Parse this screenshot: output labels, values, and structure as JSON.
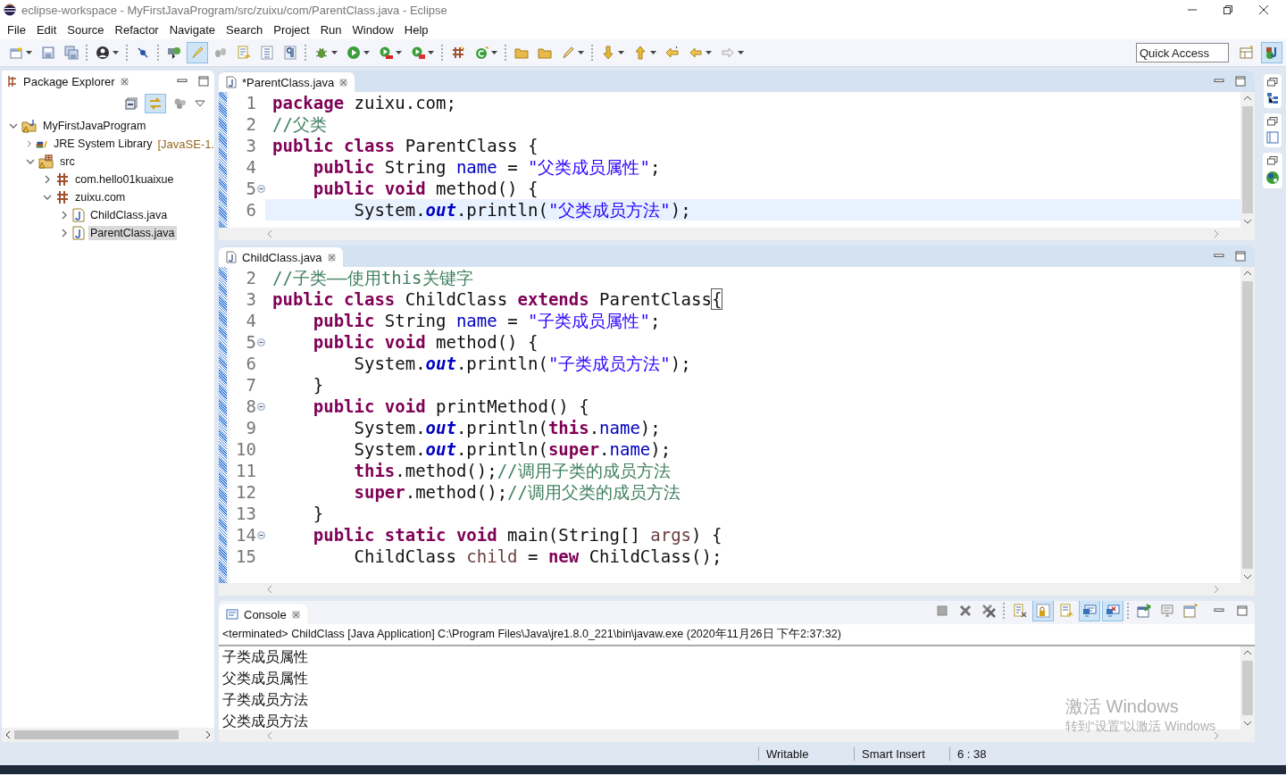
{
  "window": {
    "title": "eclipse-workspace - MyFirstJavaProgram/src/zuixu/com/ParentClass.java - Eclipse"
  },
  "menu": [
    "File",
    "Edit",
    "Source",
    "Refactor",
    "Navigate",
    "Search",
    "Project",
    "Run",
    "Window",
    "Help"
  ],
  "toolbar": [
    {
      "kind": "new",
      "dropdown": true,
      "pressed": false
    },
    {
      "kind": "save",
      "dropdown": false,
      "pressed": false
    },
    {
      "kind": "save-all",
      "dropdown": false,
      "pressed": false
    },
    {
      "kind": "separator"
    },
    {
      "kind": "person",
      "dropdown": true,
      "pressed": false
    },
    {
      "kind": "separator"
    },
    {
      "kind": "skip",
      "dropdown": false,
      "pressed": false
    },
    {
      "kind": "separator"
    },
    {
      "kind": "open-type",
      "dropdown": false,
      "pressed": false
    },
    {
      "kind": "highlighter",
      "dropdown": false,
      "pressed": true
    },
    {
      "kind": "footprints",
      "dropdown": false,
      "pressed": false
    },
    {
      "kind": "document",
      "dropdown": false,
      "pressed": false
    },
    {
      "kind": "list",
      "dropdown": false,
      "pressed": false
    },
    {
      "kind": "pilcrow",
      "dropdown": false,
      "pressed": false
    },
    {
      "kind": "separator"
    },
    {
      "kind": "bug",
      "dropdown": true,
      "pressed": false
    },
    {
      "kind": "run",
      "dropdown": true,
      "pressed": false
    },
    {
      "kind": "coverage",
      "dropdown": true,
      "pressed": false
    },
    {
      "kind": "tools",
      "dropdown": true,
      "pressed": false
    },
    {
      "kind": "separator"
    },
    {
      "kind": "grid",
      "dropdown": false,
      "pressed": false
    },
    {
      "kind": "new-class",
      "dropdown": true,
      "pressed": false
    },
    {
      "kind": "separator"
    },
    {
      "kind": "folder",
      "dropdown": false,
      "pressed": false
    },
    {
      "kind": "folder",
      "dropdown": false,
      "pressed": false
    },
    {
      "kind": "pen",
      "dropdown": true,
      "pressed": false
    },
    {
      "kind": "separator"
    },
    {
      "kind": "down-arrow",
      "dropdown": true,
      "pressed": false
    },
    {
      "kind": "up-arrow",
      "dropdown": true,
      "pressed": false
    },
    {
      "kind": "last-edit",
      "dropdown": false,
      "pressed": false
    },
    {
      "kind": "back",
      "dropdown": true,
      "pressed": false
    },
    {
      "kind": "forward",
      "dropdown": true,
      "pressed": false
    }
  ],
  "quick_access": {
    "placeholder": "Quick Access"
  },
  "perspectives": [
    {
      "kind": "open-perspective",
      "selected": false
    },
    {
      "kind": "java",
      "selected": true
    }
  ],
  "package_explorer": {
    "title": "Package Explorer",
    "tree": [
      {
        "label": "MyFirstJavaProgram",
        "kind": "project",
        "expanded": true,
        "selected": false,
        "children": [
          {
            "label": "JRE System Library",
            "decoration": "[JavaSE-1.",
            "kind": "library",
            "expanded": false,
            "selected": false
          },
          {
            "label": "src",
            "kind": "folder",
            "expanded": true,
            "selected": false,
            "children": [
              {
                "label": "com.hello01kuaixue",
                "kind": "package",
                "expanded": false,
                "selected": false
              },
              {
                "label": "zuixu.com",
                "kind": "package",
                "expanded": true,
                "selected": false,
                "children": [
                  {
                    "label": "ChildClass.java",
                    "kind": "java",
                    "expanded": false,
                    "selected": false
                  },
                  {
                    "label": "ParentClass.java",
                    "kind": "java",
                    "expanded": false,
                    "selected": true
                  }
                ]
              }
            ]
          }
        ]
      }
    ]
  },
  "editors": [
    {
      "tab": "*ParentClass.java",
      "lines": [
        {
          "num": "1",
          "foldable": false,
          "current": false,
          "tokens": [
            {
              "kind": "kw",
              "text": "package "
            },
            {
              "kind": "plain",
              "text": "zuixu.com;"
            }
          ]
        },
        {
          "num": "2",
          "foldable": false,
          "current": false,
          "tokens": [
            {
              "kind": "comment",
              "text": "//父类"
            }
          ]
        },
        {
          "num": "3",
          "foldable": false,
          "current": false,
          "tokens": [
            {
              "kind": "kw",
              "text": "public class "
            },
            {
              "kind": "plain",
              "text": "ParentClass {"
            }
          ]
        },
        {
          "num": "4",
          "foldable": false,
          "current": false,
          "tokens": [
            {
              "kind": "kw",
              "text": "    public "
            },
            {
              "kind": "plain",
              "text": "String "
            },
            {
              "kind": "field",
              "text": "name"
            },
            {
              "kind": "plain",
              "text": " = "
            },
            {
              "kind": "string",
              "text": "\"父类成员属性\""
            },
            {
              "kind": "plain",
              "text": ";"
            }
          ]
        },
        {
          "num": "5",
          "foldable": true,
          "current": false,
          "tokens": [
            {
              "kind": "kw",
              "text": "    public void "
            },
            {
              "kind": "plain",
              "text": "method() {"
            }
          ]
        },
        {
          "num": "6",
          "foldable": false,
          "current": true,
          "tokens": [
            {
              "kind": "plain",
              "text": "        System."
            },
            {
              "kind": "static",
              "text": "out"
            },
            {
              "kind": "plain",
              "text": ".println("
            },
            {
              "kind": "string",
              "text": "\"父类成员方法\""
            },
            {
              "kind": "plain",
              "text": ");"
            }
          ]
        }
      ]
    },
    {
      "tab": "ChildClass.java",
      "lines": [
        {
          "num": "2",
          "foldable": false,
          "current": false,
          "tokens": [
            {
              "kind": "comment",
              "text": "//子类——使用this关键字"
            }
          ]
        },
        {
          "num": "3",
          "foldable": false,
          "current": false,
          "tokens": [
            {
              "kind": "kw",
              "text": "public class "
            },
            {
              "kind": "plain",
              "text": "ChildClass "
            },
            {
              "kind": "kw",
              "text": "extends "
            },
            {
              "kind": "plain",
              "text": "ParentClass"
            },
            {
              "kind": "bracket",
              "text": "{"
            }
          ]
        },
        {
          "num": "4",
          "foldable": false,
          "current": false,
          "tokens": [
            {
              "kind": "kw",
              "text": "    public "
            },
            {
              "kind": "plain",
              "text": "String "
            },
            {
              "kind": "field",
              "text": "name"
            },
            {
              "kind": "plain",
              "text": " = "
            },
            {
              "kind": "string",
              "text": "\"子类成员属性\""
            },
            {
              "kind": "plain",
              "text": ";"
            }
          ]
        },
        {
          "num": "5",
          "foldable": true,
          "current": false,
          "tokens": [
            {
              "kind": "kw",
              "text": "    public void "
            },
            {
              "kind": "plain",
              "text": "method() {"
            }
          ]
        },
        {
          "num": "6",
          "foldable": false,
          "current": false,
          "tokens": [
            {
              "kind": "plain",
              "text": "        System."
            },
            {
              "kind": "static",
              "text": "out"
            },
            {
              "kind": "plain",
              "text": ".println("
            },
            {
              "kind": "string",
              "text": "\"子类成员方法\""
            },
            {
              "kind": "plain",
              "text": ");"
            }
          ]
        },
        {
          "num": "7",
          "foldable": false,
          "current": false,
          "tokens": [
            {
              "kind": "plain",
              "text": "    }"
            }
          ]
        },
        {
          "num": "8",
          "foldable": true,
          "current": false,
          "tokens": [
            {
              "kind": "kw",
              "text": "    public void "
            },
            {
              "kind": "plain",
              "text": "printMethod() {"
            }
          ]
        },
        {
          "num": "9",
          "foldable": false,
          "current": false,
          "tokens": [
            {
              "kind": "plain",
              "text": "        System."
            },
            {
              "kind": "static",
              "text": "out"
            },
            {
              "kind": "plain",
              "text": ".println("
            },
            {
              "kind": "kw",
              "text": "this"
            },
            {
              "kind": "plain",
              "text": "."
            },
            {
              "kind": "field",
              "text": "name"
            },
            {
              "kind": "plain",
              "text": ");"
            }
          ]
        },
        {
          "num": "10",
          "foldable": false,
          "current": false,
          "tokens": [
            {
              "kind": "plain",
              "text": "        System."
            },
            {
              "kind": "static",
              "text": "out"
            },
            {
              "kind": "plain",
              "text": ".println("
            },
            {
              "kind": "kw",
              "text": "super"
            },
            {
              "kind": "plain",
              "text": "."
            },
            {
              "kind": "field",
              "text": "name"
            },
            {
              "kind": "plain",
              "text": ");"
            }
          ]
        },
        {
          "num": "11",
          "foldable": false,
          "current": false,
          "tokens": [
            {
              "kind": "kw",
              "text": "        this"
            },
            {
              "kind": "plain",
              "text": ".method();"
            },
            {
              "kind": "comment",
              "text": "//调用子类的成员方法"
            }
          ]
        },
        {
          "num": "12",
          "foldable": false,
          "current": false,
          "tokens": [
            {
              "kind": "kw",
              "text": "        super"
            },
            {
              "kind": "plain",
              "text": ".method();"
            },
            {
              "kind": "comment",
              "text": "//调用父类的成员方法"
            }
          ]
        },
        {
          "num": "13",
          "foldable": false,
          "current": false,
          "tokens": [
            {
              "kind": "plain",
              "text": "    }"
            }
          ]
        },
        {
          "num": "14",
          "foldable": true,
          "current": false,
          "tokens": [
            {
              "kind": "kw",
              "text": "    public static void "
            },
            {
              "kind": "plain",
              "text": "main(String[] "
            },
            {
              "kind": "local",
              "text": "args"
            },
            {
              "kind": "plain",
              "text": ") {"
            }
          ]
        },
        {
          "num": "15",
          "foldable": false,
          "current": false,
          "tokens": [
            {
              "kind": "plain",
              "text": "        ChildClass "
            },
            {
              "kind": "local",
              "text": "child"
            },
            {
              "kind": "plain",
              "text": " = "
            },
            {
              "kind": "kw",
              "text": "new "
            },
            {
              "kind": "plain",
              "text": "ChildClass();"
            }
          ]
        }
      ]
    }
  ],
  "console": {
    "tab": "Console",
    "toolbar": [
      {
        "kind": "stop",
        "pressed": false
      },
      {
        "kind": "remove",
        "pressed": false
      },
      {
        "kind": "remove-all",
        "pressed": false
      },
      {
        "kind": "separator"
      },
      {
        "kind": "clear",
        "pressed": false
      },
      {
        "kind": "scroll-lock",
        "pressed": true
      },
      {
        "kind": "word-wrap",
        "pressed": false
      },
      {
        "kind": "show-out",
        "pressed": true
      },
      {
        "kind": "show-err",
        "pressed": true
      },
      {
        "kind": "separator"
      },
      {
        "kind": "pin",
        "pressed": false
      },
      {
        "kind": "display",
        "pressed": false
      },
      {
        "kind": "new-console",
        "pressed": false
      }
    ],
    "status": "<terminated> ChildClass [Java Application] C:\\Program Files\\Java\\jre1.8.0_221\\bin\\javaw.exe (2020年11月26日 下午2:37:32)",
    "output": [
      "子类成员属性",
      "父类成员属性",
      "子类成员方法",
      "父类成员方法"
    ]
  },
  "activation_notice": {
    "title": "激活 Windows",
    "text": "转到“设置”以激活 Windows"
  },
  "status_bar": [
    "Writable",
    "Smart Insert",
    "6 : 38"
  ]
}
